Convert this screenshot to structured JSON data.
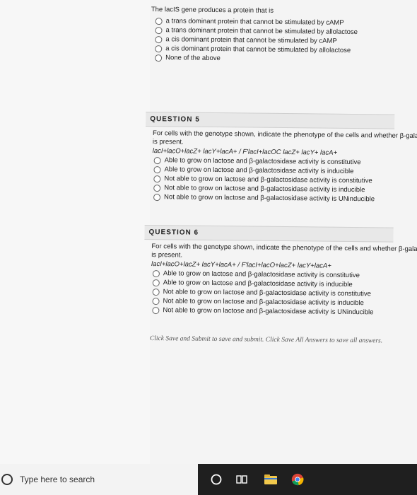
{
  "q4": {
    "intro": "The lacIS gene produces a protein that is",
    "options": [
      "a trans dominant protein that cannot be stimulated by cAMP",
      "a trans dominant protein that cannot be stimulated by allolactose",
      "a cis dominant protein that cannot be stimulated by cAMP",
      "a cis dominant protein that cannot be stimulated by allolactose",
      "None of the above"
    ]
  },
  "q5": {
    "heading": "QUESTION 5",
    "prompt_line1": "For cells with the genotype shown, indicate the phenotype of the cells and whether β-galactosidase activity is constitutive or inducible. Assume glucose is absent and lactose",
    "prompt_line2": "is present.",
    "genotype": "lacI+lacO+lacZ+ lacY+lacA+ / F′lacI+lacOC lacZ+ lacY+ lacA+",
    "options": [
      "Able to grow on lactose and β-galactosidase activity is constitutive",
      "Able to grow on lactose and β-galactosidase activity is inducible",
      "Not able to grow on lactose and β-galactosidase activity is constitutive",
      "Not able to grow on lactose and β-galactosidase activity is inducible",
      "Not able to grow on lactose and β-galactosidase activity is UNinducible"
    ]
  },
  "q6": {
    "heading": "QUESTION 6",
    "prompt_line1": "For cells with the genotype shown, indicate the phenotype of the cells and whether β-galactosidase activity is constitutive or inducible. Assume glucose is absent and lactose",
    "prompt_line2": "is present.",
    "genotype": "lacI+lacO+lacZ+ lacY+lacA+ / F′lacI+lacO+lacZ+ lacY+lacA+",
    "options": [
      "Able to grow on lactose and β-galactosidase activity is constitutive",
      "Able to grow on lactose and β-galactosidase activity is inducible",
      "Not able to grow on lactose and β-galactosidase activity is constitutive",
      "Not able to grow on lactose and β-galactosidase activity is inducible",
      "Not able to grow on lactose and β-galactosidase activity is UNinducible"
    ]
  },
  "footer": "Click Save and Submit to save and submit. Click Save All Answers to save all answers.",
  "taskbar": {
    "search_placeholder": "Type here to search",
    "icons": [
      "cortana-icon",
      "task-view-icon",
      "file-explorer-icon",
      "chrome-icon"
    ]
  }
}
